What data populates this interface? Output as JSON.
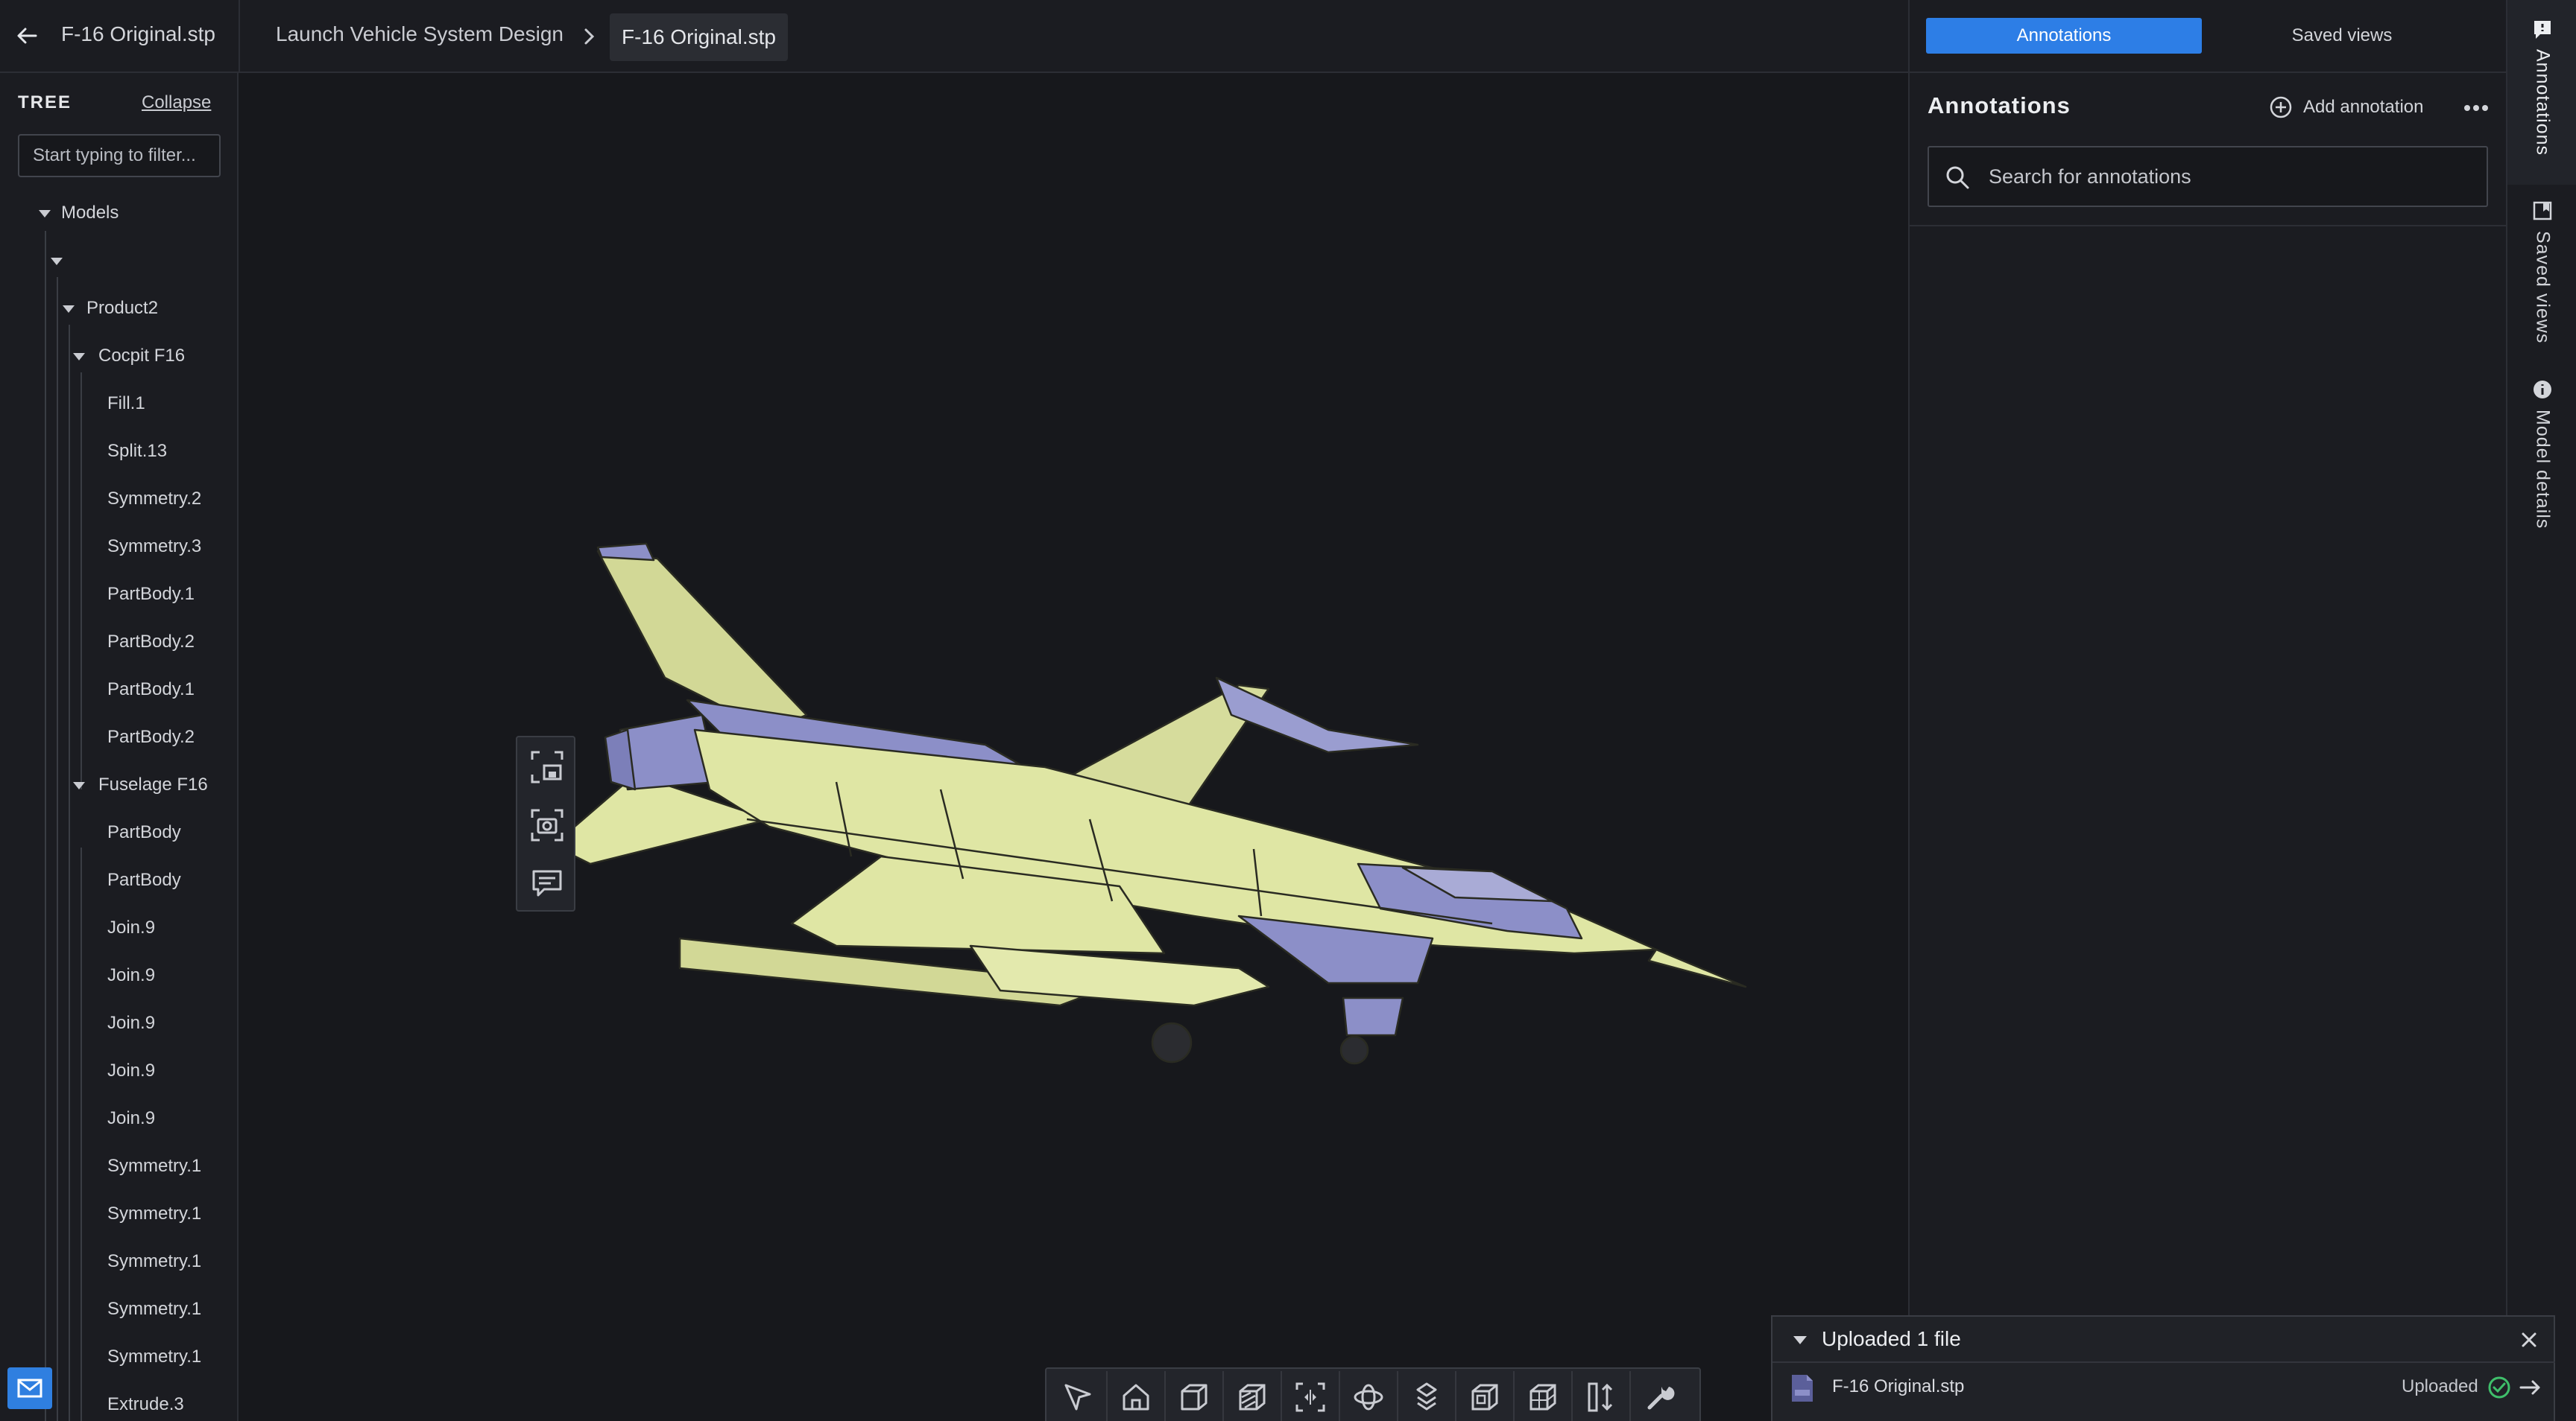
{
  "header": {
    "file_title": "F-16 Original.stp",
    "breadcrumb_project": "Launch Vehicle System Design",
    "breadcrumb_current": "F-16 Original.stp"
  },
  "tree": {
    "heading": "TREE",
    "collapse_label": "Collapse",
    "filter_placeholder": "Start typing to filter...",
    "items": [
      {
        "label": "Models",
        "expanded": true
      },
      {
        "label": "",
        "expanded": true
      },
      {
        "label": "Product2",
        "expanded": true
      },
      {
        "label": "Cocpit F16",
        "expanded": true
      },
      {
        "label": "Fill.1"
      },
      {
        "label": "Split.13"
      },
      {
        "label": "Symmetry.2"
      },
      {
        "label": "Symmetry.3"
      },
      {
        "label": "PartBody.1"
      },
      {
        "label": "PartBody.2"
      },
      {
        "label": "PartBody.1"
      },
      {
        "label": "PartBody.2"
      },
      {
        "label": "Fuselage F16",
        "expanded": true
      },
      {
        "label": "PartBody"
      },
      {
        "label": "PartBody"
      },
      {
        "label": "Join.9"
      },
      {
        "label": "Join.9"
      },
      {
        "label": "Join.9"
      },
      {
        "label": "Join.9"
      },
      {
        "label": "Join.9"
      },
      {
        "label": "Symmetry.1"
      },
      {
        "label": "Symmetry.1"
      },
      {
        "label": "Symmetry.1"
      },
      {
        "label": "Symmetry.1"
      },
      {
        "label": "Symmetry.1"
      },
      {
        "label": "Extrude.3"
      }
    ]
  },
  "viewport": {
    "side_tools": [
      "fit-selection-icon",
      "screenshot-icon",
      "comment-icon"
    ],
    "toolbar": [
      "select-icon",
      "home-icon",
      "view-cube-icon",
      "section-icon",
      "fit-view-icon",
      "orbit-icon",
      "explode-icon",
      "isometric-icon",
      "wireframe-icon",
      "measure-icon",
      "settings-wrench-icon"
    ],
    "model_colors": {
      "body": "#dfe6a4",
      "accent": "#8c8fc8",
      "outline": "#2a2b22"
    }
  },
  "annotations_panel": {
    "tab_annotations": "Annotations",
    "tab_saved_views": "Saved views",
    "title": "Annotations",
    "add_label": "Add annotation",
    "search_placeholder": "Search for annotations"
  },
  "rail": {
    "annotations": "Annotations",
    "saved_views": "Saved views",
    "model_details": "Model details"
  },
  "upload": {
    "title": "Uploaded 1 file",
    "file_name": "F-16 Original.stp",
    "status": "Uploaded"
  },
  "colors": {
    "accent": "#2d7ee6",
    "background": "#17181c",
    "panel": "#1b1c21",
    "success": "#3fbf6b"
  }
}
